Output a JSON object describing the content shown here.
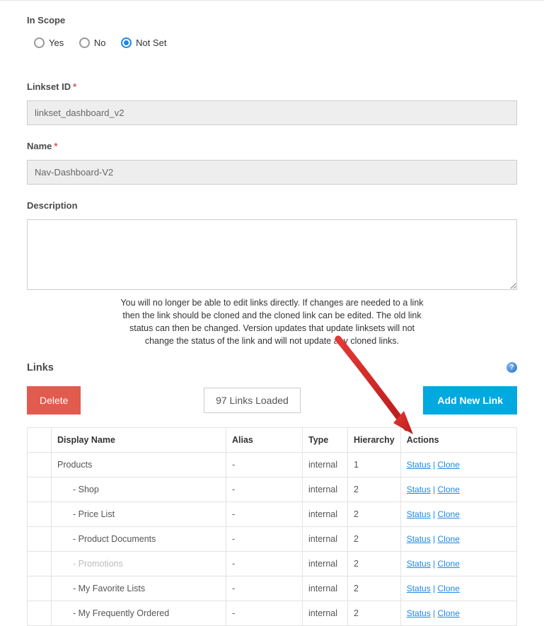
{
  "scope": {
    "label": "In Scope",
    "options": [
      "Yes",
      "No",
      "Not Set"
    ],
    "selected": "Not Set"
  },
  "linksetId": {
    "label": "Linkset ID",
    "required": "*",
    "value": "linkset_dashboard_v2"
  },
  "name": {
    "label": "Name",
    "required": "*",
    "value": "Nav-Dashboard-V2"
  },
  "description": {
    "label": "Description",
    "value": ""
  },
  "callout": "You will no longer be able to edit links directly. If changes are needed to a link then the link should be cloned and the cloned link can be edited. The old link status can then be changed. Version updates that update linksets will not change the status of the link and will not update any cloned links.",
  "linksSection": {
    "heading": "Links",
    "deleteBtn": "Delete",
    "loadedText": "97 Links Loaded",
    "addBtn": "Add New Link"
  },
  "table": {
    "headers": {
      "displayName": "Display Name",
      "alias": "Alias",
      "type": "Type",
      "hierarchy": "Hierarchy",
      "actions": "Actions"
    },
    "actionLabels": {
      "status": "Status",
      "clone": "Clone"
    },
    "rows": [
      {
        "name": "Products",
        "indent": 1,
        "alias": "-",
        "type": "internal",
        "hierarchy": "1",
        "dim": false
      },
      {
        "name": "- Shop",
        "indent": 2,
        "alias": "-",
        "type": "internal",
        "hierarchy": "2",
        "dim": false
      },
      {
        "name": "- Price List",
        "indent": 2,
        "alias": "-",
        "type": "internal",
        "hierarchy": "2",
        "dim": false
      },
      {
        "name": "- Product Documents",
        "indent": 2,
        "alias": "-",
        "type": "internal",
        "hierarchy": "2",
        "dim": false
      },
      {
        "name": "- Promotions",
        "indent": 2,
        "alias": "-",
        "type": "internal",
        "hierarchy": "2",
        "dim": true
      },
      {
        "name": "- My Favorite Lists",
        "indent": 2,
        "alias": "-",
        "type": "internal",
        "hierarchy": "2",
        "dim": false
      },
      {
        "name": "- My Frequently Ordered",
        "indent": 2,
        "alias": "-",
        "type": "internal",
        "hierarchy": "2",
        "dim": false
      }
    ]
  }
}
